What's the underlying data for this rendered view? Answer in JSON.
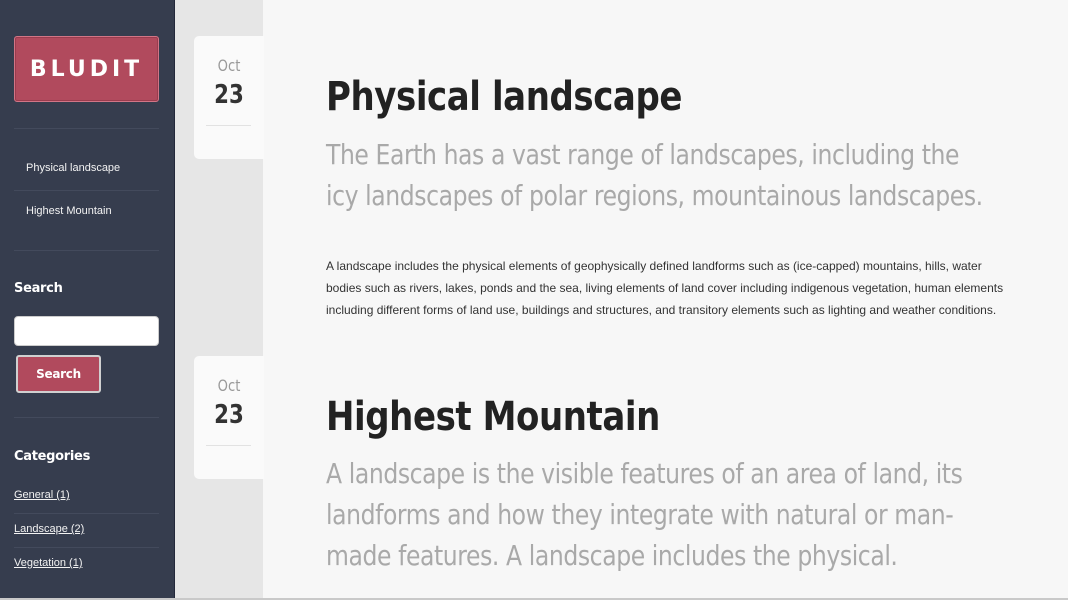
{
  "sidebar": {
    "logo": "BLUDIT",
    "pages": [
      {
        "label": "Physical landscape"
      },
      {
        "label": "Highest Mountain"
      }
    ],
    "search": {
      "heading": "Search",
      "placeholder": "",
      "button_label": "Search"
    },
    "categories": {
      "heading": "Categories",
      "items": [
        {
          "label": "General (1)"
        },
        {
          "label": "Landscape (2)"
        },
        {
          "label": "Vegetation (1)"
        }
      ]
    }
  },
  "posts": [
    {
      "month": "Oct",
      "day": "23",
      "title": "Physical landscape",
      "description": "The Earth has a vast range of landscapes, including the icy landscapes of polar regions, mountainous landscapes.",
      "body": "A landscape includes the physical elements of geophysically defined landforms such as (ice-capped) mountains, hills, water bodies such as rivers, lakes, ponds and the sea, living elements of land cover including indigenous vegetation, human elements including different forms of land use, buildings and structures, and transitory elements such as lighting and weather conditions."
    },
    {
      "month": "Oct",
      "day": "23",
      "title": "Highest Mountain",
      "description": "A landscape is the visible features of an area of land, its landforms and how they integrate with natural or man-made features. A landscape includes the physical."
    }
  ],
  "colors": {
    "sidebar_bg": "#363d4e",
    "accent": "#b14a5d",
    "content_bg": "#f7f7f7"
  }
}
